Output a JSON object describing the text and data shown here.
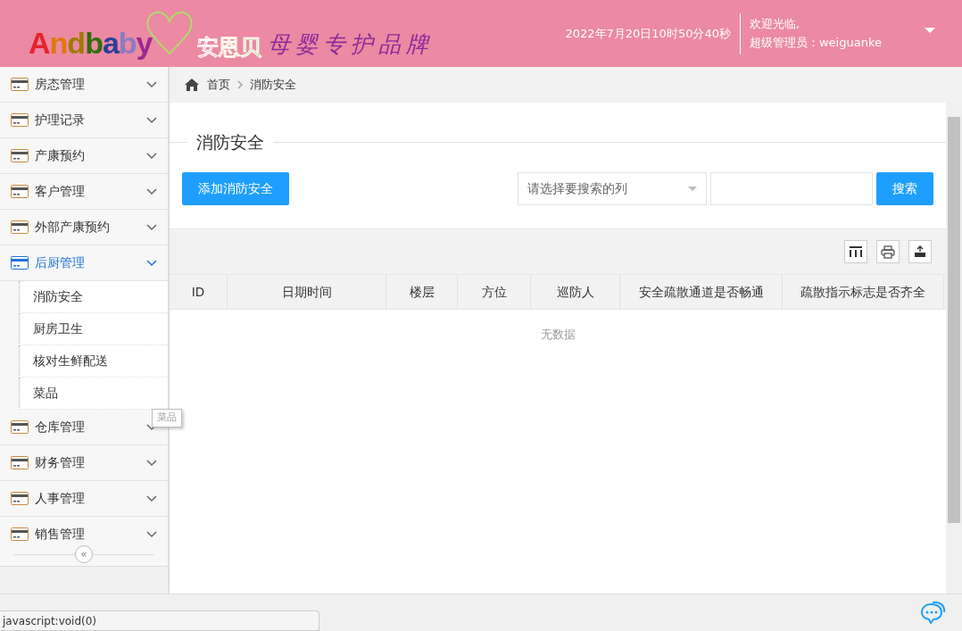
{
  "header": {
    "logo_latin": "Andbaby",
    "logo_cn": "安恩贝",
    "slogan": "母婴专护品牌",
    "datetime": "2022年7月20日10时50分40秒",
    "welcome": "欢迎光临,",
    "user": "超级管理员：weiguanke"
  },
  "sidebar": {
    "items": [
      {
        "label": "房态管理",
        "expanded": false
      },
      {
        "label": "护理记录",
        "expanded": false
      },
      {
        "label": "产康预约",
        "expanded": false
      },
      {
        "label": "客户管理",
        "expanded": false
      },
      {
        "label": "外部产康预约",
        "expanded": false
      },
      {
        "label": "后厨管理",
        "expanded": true,
        "children": [
          {
            "label": "消防安全"
          },
          {
            "label": "厨房卫生"
          },
          {
            "label": "核对生鲜配送"
          },
          {
            "label": "菜品"
          }
        ]
      },
      {
        "label": "仓库管理",
        "expanded": false
      },
      {
        "label": "财务管理",
        "expanded": false
      },
      {
        "label": "人事管理",
        "expanded": false
      },
      {
        "label": "销售管理",
        "expanded": false
      }
    ],
    "collapse": "«",
    "tooltip": "菜品"
  },
  "breadcrumb": [
    "首页",
    "消防安全"
  ],
  "section_title": "消防安全",
  "toolbar": {
    "add_button": "添加消防安全",
    "column_select": {
      "placeholder": "请选择要搜索的列"
    },
    "search_button": "搜索"
  },
  "table": {
    "columns": [
      "ID",
      "日期时间",
      "楼层",
      "方位",
      "巡防人",
      "安全疏散通道是否畅通",
      "疏散指示标志是否齐全"
    ],
    "empty_text": "无数据"
  },
  "status_bar": "javascript:void(0)"
}
